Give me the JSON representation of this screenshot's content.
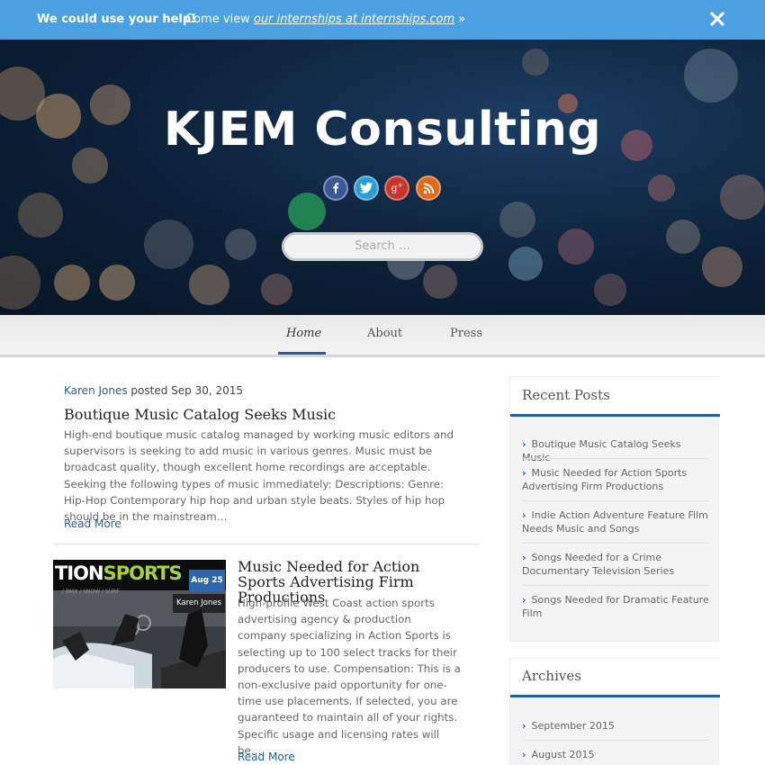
{
  "notice": {
    "strong": "We could use your help!",
    "text_prefix": "Come view ",
    "link_text": "our internships at internships.com",
    "text_suffix": " »"
  },
  "site": {
    "title": "KJEM Consulting",
    "search_placeholder": "Search …"
  },
  "social": [
    {
      "name": "facebook",
      "glyph": "f",
      "color": "#3b5998"
    },
    {
      "name": "twitter",
      "glyph": "t",
      "color": "#2a9fd6"
    },
    {
      "name": "google-plus",
      "glyph": "g+",
      "color": "#c8352b"
    },
    {
      "name": "rss",
      "glyph": "rss",
      "color": "#e06a1b"
    }
  ],
  "nav": {
    "home": "Home",
    "about": "About",
    "press": "Press"
  },
  "posts": [
    {
      "author": "Karen Jones",
      "posted": " posted Sep 30, 2015",
      "title": "Boutique Music Catalog Seeks Music",
      "excerpt": "High-end boutique music catalog managed by working music editors and supervisors is seeking to add music in various genres. Music must be broadcast quality, though excellent home recordings are acceptable. Seeking the following types of music immediately: Descriptions: Genre: Hip-Hop Contemporary hip hop and urban style beats. Styles of hip hop should be in the mainstream…",
      "read_more": "Read More"
    },
    {
      "title": "Music Needed for Action Sports Advertising Firm Productions",
      "date_badge": "Aug 25",
      "author_badge": "Karen Jones",
      "thumb_text_a": "TION",
      "thumb_text_b": "SPORTS",
      "thumb_sub": "/ BMX / SNOW / SURF",
      "excerpt": "High-profile West Coast action sports advertising agency & production company specializing in Action Sports is selecting up to 100 select tracks for their producers to use. Compensation: This is a non-exclusive paid opportunity for one-time use placements.  If selected, you are guaranteed to maintain all of your rights.  Specific usage and licensing rates will be…",
      "read_more": "Read More"
    }
  ],
  "sidebar": {
    "recent_title": "Recent Posts",
    "recent": [
      "Boutique Music Catalog Seeks Music",
      "Music Needed for Action Sports Advertising Firm Productions",
      "Indie Action Adventure Feature Film Needs Music and Songs",
      "Songs Needed for a Crime Documentary Television Series",
      "Songs Needed for Dramatic Feature Film"
    ],
    "archives_title": "Archives",
    "archives": [
      "September 2015",
      "August 2015"
    ]
  },
  "colors": {
    "accent": "#1f5ea8",
    "notice_bg": "#4aa0e0"
  }
}
